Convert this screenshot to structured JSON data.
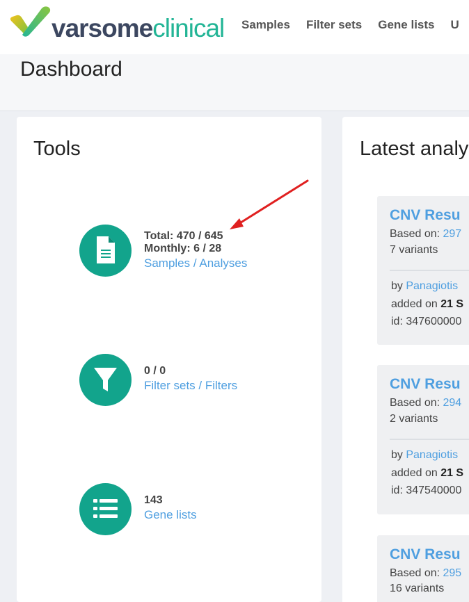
{
  "brand": {
    "logo_part1": "varsome",
    "logo_part2": "clinical",
    "colors": {
      "accent": "#12a48c",
      "link": "#4f9fe0",
      "logo_dark": "#3c4760",
      "logo_green": "#23b596"
    }
  },
  "nav": {
    "items": [
      "Samples",
      "Filter sets",
      "Gene lists",
      "U"
    ]
  },
  "page": {
    "title": "Dashboard"
  },
  "tools": {
    "title": "Tools",
    "items": [
      {
        "icon": "document-icon",
        "stat1": "Total: 470 / 645",
        "stat2": "Monthly: 6 / 28",
        "link": "Samples / Analyses"
      },
      {
        "icon": "filter-icon",
        "stat1": "0 / 0",
        "link": "Filter sets / Filters"
      },
      {
        "icon": "list-icon",
        "stat1": "143",
        "link": "Gene lists"
      }
    ]
  },
  "latest": {
    "title": "Latest analy",
    "items": [
      {
        "title": "CNV Resu",
        "based_label": "Based on: ",
        "based_value": "297",
        "variants": "7 variants",
        "by_label": "by ",
        "by_value": "Panagiotis",
        "added_label": "added on ",
        "added_value": "21 S",
        "id": "id: 347600000"
      },
      {
        "title": "CNV Resu",
        "based_label": "Based on: ",
        "based_value": "294",
        "variants": "2 variants",
        "by_label": "by ",
        "by_value": "Panagiotis",
        "added_label": "added on ",
        "added_value": "21 S",
        "id": "id: 347540000"
      },
      {
        "title": "CNV Resu",
        "based_label": "Based on: ",
        "based_value": "295",
        "variants": "16 variants"
      }
    ]
  }
}
